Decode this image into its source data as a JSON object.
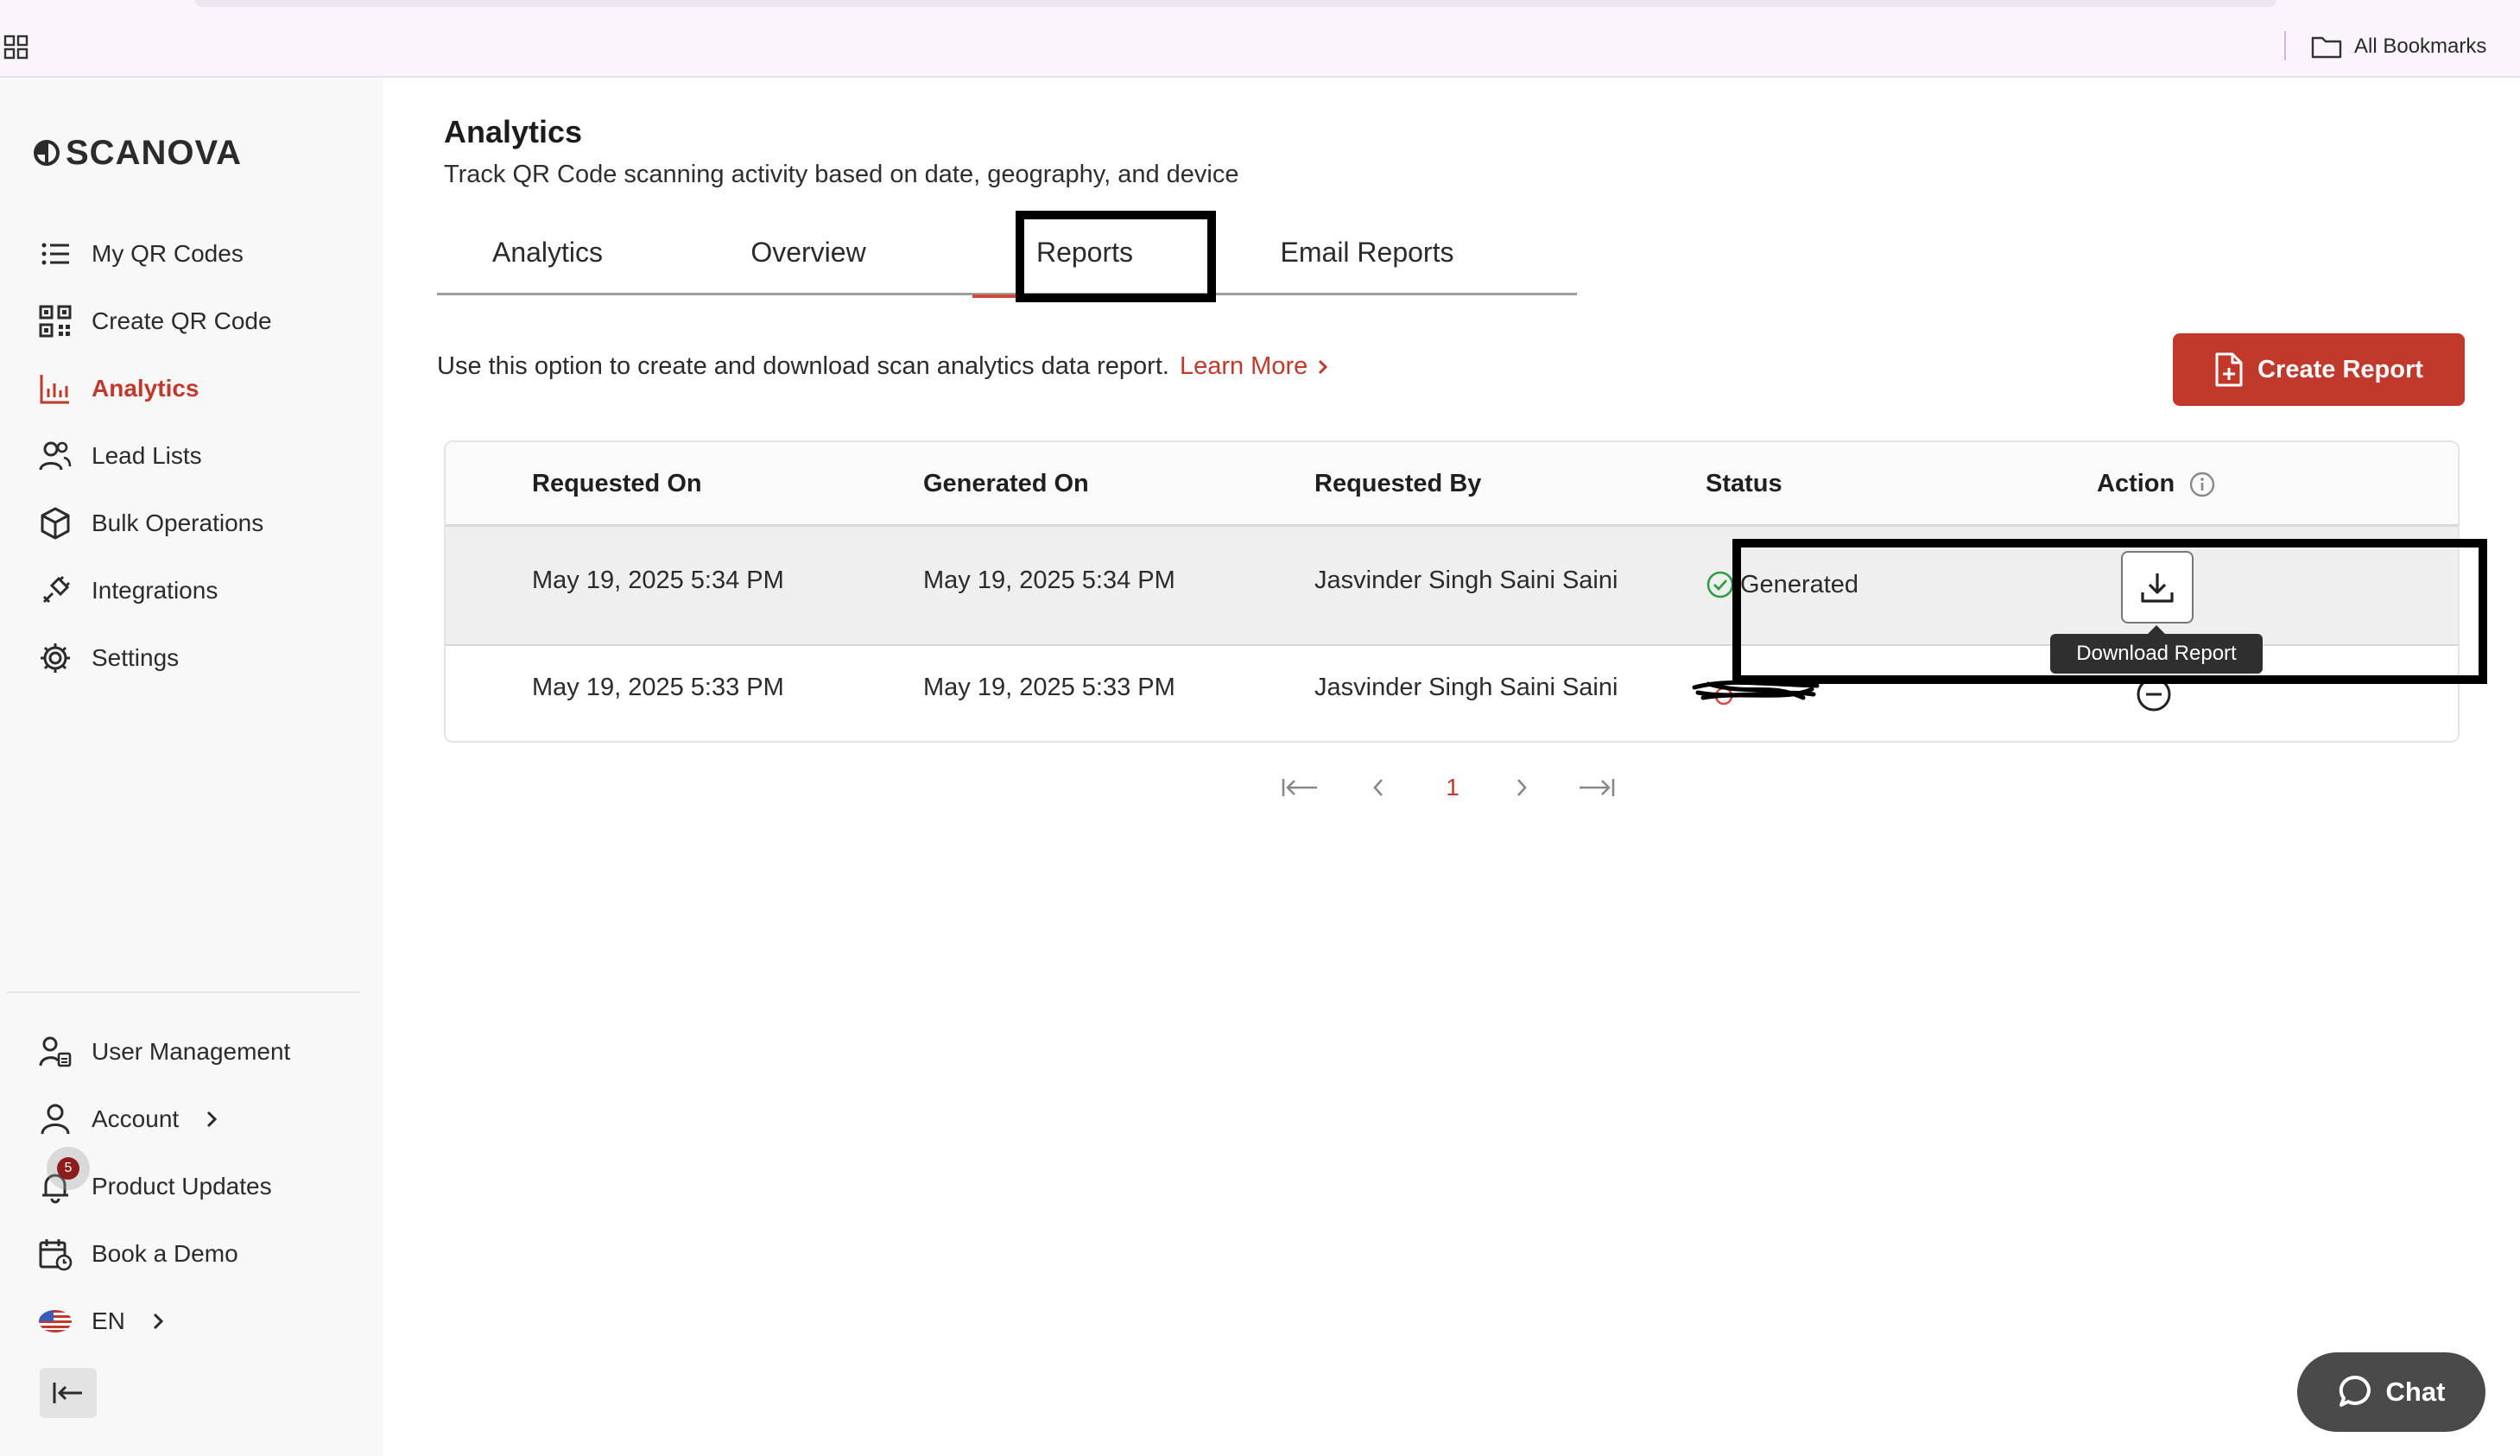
{
  "browser": {
    "bookmarks_label": "All Bookmarks"
  },
  "sidebar": {
    "logo_text": "SCANOVA",
    "nav": [
      {
        "label": "My QR Codes",
        "icon": "list-icon"
      },
      {
        "label": "Create QR Code",
        "icon": "qr-code-icon"
      },
      {
        "label": "Analytics",
        "icon": "bar-chart-icon",
        "active": true
      },
      {
        "label": "Lead Lists",
        "icon": "users-icon"
      },
      {
        "label": "Bulk Operations",
        "icon": "box-icon"
      },
      {
        "label": "Integrations",
        "icon": "plug-icon"
      },
      {
        "label": "Settings",
        "icon": "gear-icon"
      }
    ],
    "bottom": [
      {
        "label": "User Management",
        "icon": "user-manage-icon"
      },
      {
        "label": "Account",
        "icon": "user-icon"
      },
      {
        "label": "Product Updates",
        "icon": "bell-icon",
        "badge": "5"
      },
      {
        "label": "Book a Demo",
        "icon": "calendar-icon"
      },
      {
        "label": "EN",
        "icon": "us-flag-icon"
      }
    ]
  },
  "main": {
    "title": "Analytics",
    "subtitle": "Track QR Code scanning activity based on date, geography, and device",
    "tabs": [
      {
        "label": "Analytics"
      },
      {
        "label": "Overview"
      },
      {
        "label": "Reports",
        "active": true
      },
      {
        "label": "Email Reports"
      }
    ],
    "intro_text": "Use this option to create and download scan analytics data report.",
    "learn_more": "Learn More",
    "create_button": "Create Report",
    "table": {
      "headers": [
        "Requested On",
        "Generated On",
        "Requested By",
        "Status",
        "Action"
      ],
      "rows": [
        {
          "requested_on": "May 19, 2025 5:34 PM",
          "generated_on": "May 19, 2025 5:34 PM",
          "requested_by": "Jasvinder Singh Saini Saini",
          "status": "Generated"
        },
        {
          "requested_on": "May 19, 2025 5:33 PM",
          "generated_on": "May 19, 2025 5:33 PM",
          "requested_by": "Jasvinder Singh Saini Saini",
          "status": ""
        }
      ]
    },
    "tooltip": "Download Report",
    "pagination": {
      "current_page": "1"
    },
    "chat_label": "Chat"
  },
  "colors": {
    "accent": "#c0392b",
    "success": "#2e9e44",
    "sidebar_bg": "#f8f8f8",
    "chat_bg": "#4a4a4a"
  }
}
